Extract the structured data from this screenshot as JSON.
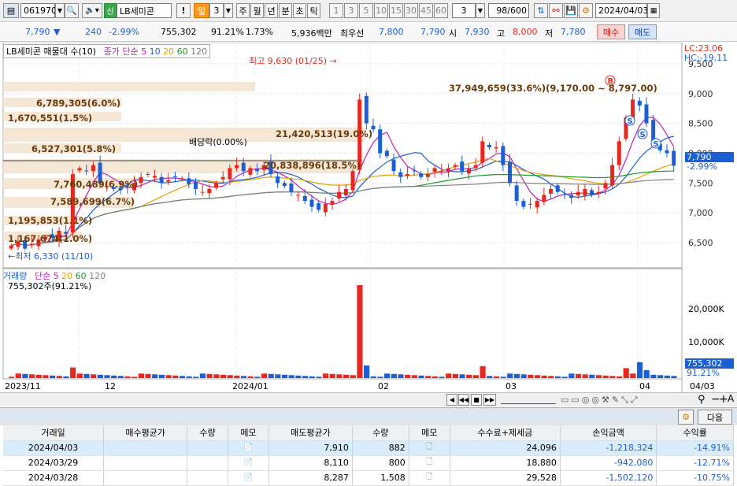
{
  "toolbar": {
    "code": "061970",
    "badge": "신",
    "name": "LB세미콘",
    "exclaim": "!",
    "period_active": "일",
    "period_num": "3",
    "periods": [
      "주",
      "월",
      "년",
      "분",
      "초",
      "틱"
    ],
    "intervals": [
      "1",
      "3",
      "5",
      "10",
      "15",
      "30",
      "45",
      "60"
    ],
    "interval_value": "3",
    "count": "98",
    "count_total": "/600",
    "date": "2024/04/03"
  },
  "quote": {
    "price": "7,790",
    "change_arrow": "▼",
    "change": "240",
    "change_pct": "-2.99%",
    "volume": "755,302",
    "vol_ratio": "91.21%",
    "turnover": "1.73%",
    "amount": "5,936백만",
    "bid_label": "최우선",
    "best_ask": "7,800",
    "best_bid": "7,790",
    "open_label": "시",
    "open": "7,930",
    "high_label": "고",
    "high": "8,000",
    "low_label": "저",
    "low": "7,780",
    "buy_btn": "매수",
    "sell_btn": "매도"
  },
  "chart": {
    "legend_title": "LB세미콘 매물대 수(10)",
    "legend_ma_label": "종가 단순",
    "legend_ma": [
      "5",
      "10",
      "20",
      "60",
      "120"
    ],
    "lc_label": "LC:23.06",
    "hc_label": "HC:-19.11",
    "price_axis": [
      "9,500",
      "9,000",
      "8,500",
      "8,000",
      "7,500",
      "7,000",
      "6,500"
    ],
    "current_price_tag": "7,790",
    "current_pct_tag": "-2.99%",
    "high_marker": "최고 9,630 (01/25)",
    "low_marker": "최저 6,330 (11/10)",
    "dividend_marker": "배당락(0.00%)",
    "buy_marker": "B",
    "sell_marker": "S",
    "volume_profile": [
      "37,949,659(33.6%)(9,170.00 ~ 8,797.00)",
      "6,789,305(6.0%)",
      "1,670,551(1.5%)",
      "21,420,513(19.0%)",
      "6,527,301(5.8%)",
      "20,838,896(18.5%)",
      "7,760,489(6.9%)",
      "7,589,699(6.7%)",
      "1,195,853(1.1%)",
      "1,167,674(1.0%)"
    ]
  },
  "volume": {
    "legend_title": "거래량",
    "legend_ma_label": "단순",
    "legend_ma": [
      "5",
      "20",
      "60",
      "120"
    ],
    "current": "755,302주(91.21%)",
    "axis": [
      "20,000K",
      "10,000K"
    ],
    "current_tag": "755,302",
    "current_pct_tag": "91.21%"
  },
  "xaxis": [
    "2023/11",
    "12",
    "2024/01",
    "02",
    "03",
    "04",
    "04/03"
  ],
  "panel": {
    "next_btn": "다음"
  },
  "table": {
    "headers": [
      "거래일",
      "매수평균가",
      "수량",
      "메모",
      "매도평균가",
      "수량",
      "메모",
      "수수료+제세금",
      "손익금액",
      "수익률"
    ],
    "rows": [
      {
        "date": "2024/04/03",
        "buy_avg": "",
        "buy_qty": "",
        "sell_avg": "7,910",
        "sell_qty": "882",
        "fee": "24,096",
        "pnl": "-1,218,324",
        "ret": "-14.91%"
      },
      {
        "date": "2024/03/29",
        "buy_avg": "",
        "buy_qty": "",
        "sell_avg": "8,110",
        "sell_qty": "800",
        "fee": "18,880",
        "pnl": "-942,080",
        "ret": "-12.71%"
      },
      {
        "date": "2024/03/28",
        "buy_avg": "",
        "buy_qty": "",
        "sell_avg": "8,287",
        "sell_qty": "1,508",
        "fee": "29,528",
        "pnl": "-1,502,120",
        "ret": "-10.75%"
      }
    ]
  },
  "colors": {
    "up": "#e8281e",
    "down": "#1c5fd4",
    "ma5": "#c020c0",
    "ma10": "#1c5fd4",
    "ma20": "#e8a000",
    "ma60": "#1c9a2c",
    "ma120": "#808080"
  }
}
